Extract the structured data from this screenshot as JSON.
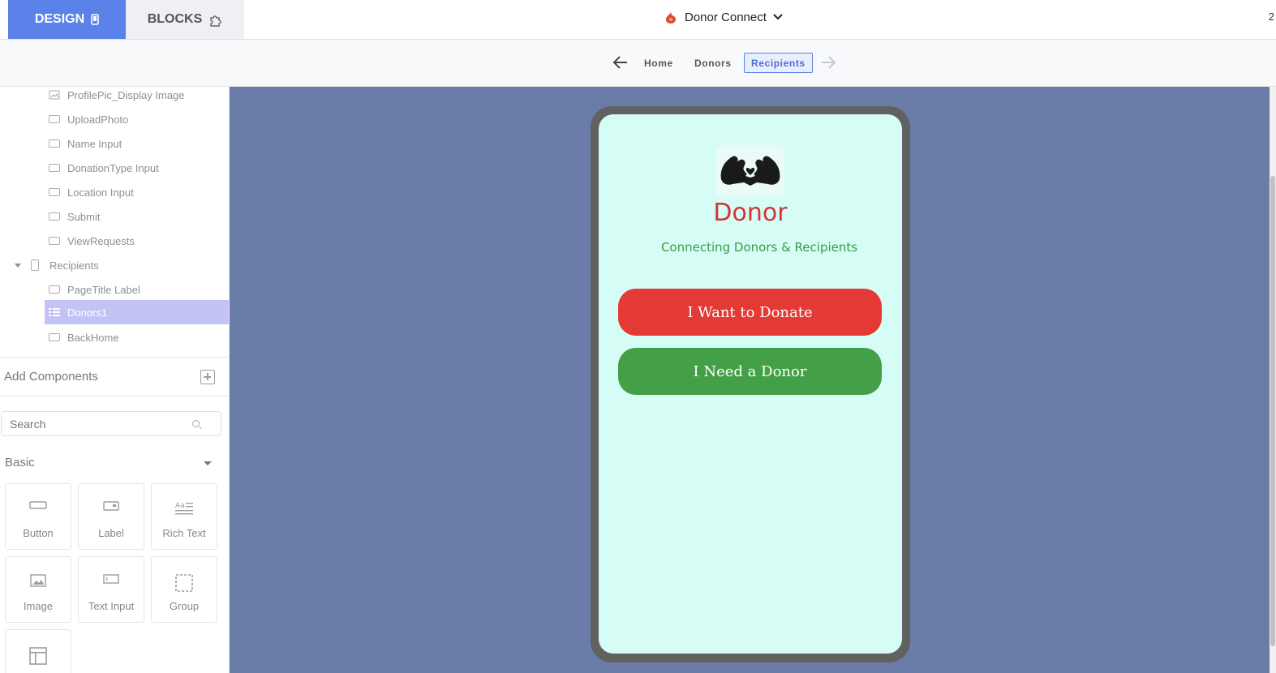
{
  "header": {
    "design_tab": "DESIGN",
    "blocks_tab": "BLOCKS",
    "app_name": "Donor Connect",
    "right_text": "2"
  },
  "nav": {
    "home": "Home",
    "donors": "Donors",
    "recipients": "Recipients"
  },
  "tree": {
    "items": [
      {
        "label": "ProfilePic_Display Image"
      },
      {
        "label": "UploadPhoto"
      },
      {
        "label": "Name Input"
      },
      {
        "label": "DonationType Input"
      },
      {
        "label": "Location Input"
      },
      {
        "label": "Submit"
      },
      {
        "label": "ViewRequests"
      }
    ],
    "recipients_screen": "Recipients",
    "recipients_children": [
      {
        "label": "PageTitle Label"
      },
      {
        "label": "Donors1"
      },
      {
        "label": "BackHome"
      }
    ]
  },
  "components": {
    "heading": "Add Components",
    "search_placeholder": "Search",
    "category": "Basic",
    "tiles": [
      {
        "label": "Button",
        "icon": "button-icon"
      },
      {
        "label": "Label",
        "icon": "label-icon"
      },
      {
        "label": "Rich Text",
        "icon": "rich-text-icon"
      },
      {
        "label": "Image",
        "icon": "image-icon"
      },
      {
        "label": "Text Input",
        "icon": "text-input-icon"
      },
      {
        "label": "Group",
        "icon": "group-icon"
      },
      {
        "label": "",
        "icon": "layout-icon"
      }
    ]
  },
  "app_screen": {
    "title": "Donor",
    "subtitle": "Connecting Donors & Recipients",
    "donate_button": "I Want to Donate",
    "need_button": "I Need a Donor"
  },
  "colors": {
    "accent": "#5b82e8",
    "canvas": "#6a7ca8",
    "screen_bg": "#d6fcf6",
    "title_red": "#d33535",
    "subtitle_green": "#3f9a44",
    "donate_red": "#e53935",
    "need_green": "#43a047"
  }
}
